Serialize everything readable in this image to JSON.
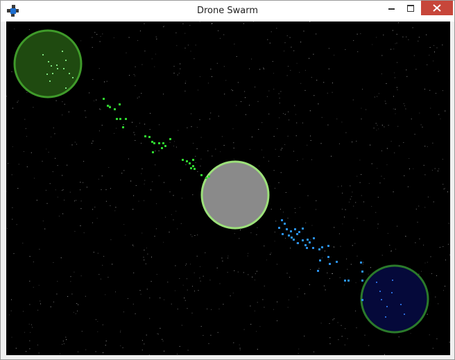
{
  "window": {
    "title": "Drone Swarm"
  },
  "titlebar_buttons": {
    "minimize_icon": "minimize-icon",
    "maximize_icon": "maximize-icon",
    "close_icon": "close-icon"
  },
  "game": {
    "background_color": "#000000",
    "star_color": "#bfbfbf",
    "bases": {
      "green": {
        "fill": "#1f4a10",
        "stroke": "#3f9a2a"
      },
      "neutral": {
        "fill": "#8a8a8a",
        "stroke": "#9ce07a"
      },
      "blue": {
        "fill": "#05093a",
        "stroke": "#2b7a2b"
      }
    },
    "drone_colors": {
      "green": "#2fd62f",
      "blue": "#2a8fe8",
      "green_base_inner": "#7ee07e",
      "blue_base_inner": "#2a6ad8"
    }
  }
}
